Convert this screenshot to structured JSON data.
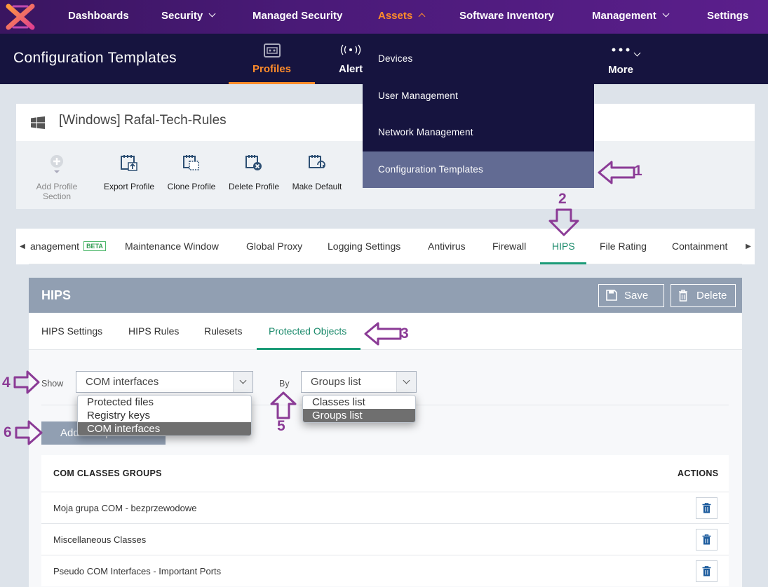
{
  "topnav": {
    "items": [
      {
        "label": "Dashboards"
      },
      {
        "label": "Security"
      },
      {
        "label": "Managed Security"
      },
      {
        "label": "Assets"
      },
      {
        "label": "Software Inventory"
      },
      {
        "label": "Management"
      },
      {
        "label": "Settings"
      }
    ],
    "active": "Assets"
  },
  "subheader": {
    "title": "Configuration Templates",
    "tabs": [
      {
        "label": "Profiles",
        "icon": "profiles-icon"
      },
      {
        "label": "Alert",
        "icon": "alerts-icon"
      },
      {
        "label": "More",
        "icon": "more-dots-icon"
      }
    ]
  },
  "assets_menu": {
    "items": [
      "Devices",
      "User Management",
      "Network Management",
      "Configuration Templates"
    ],
    "selected": "Configuration Templates"
  },
  "profile": {
    "name": "[Windows] Rafal-Tech-Rules",
    "os_icon": "windows-icon",
    "toolbar": {
      "add_section": "Add Profile Section",
      "export": "Export Profile",
      "clone": "Clone Profile",
      "delete": "Delete Profile",
      "make_default": "Make Default"
    }
  },
  "section_tabs": {
    "items": [
      {
        "label": "anagement",
        "badge": "BETA"
      },
      {
        "label": "Maintenance Window"
      },
      {
        "label": "Global Proxy"
      },
      {
        "label": "Logging Settings"
      },
      {
        "label": "Antivirus"
      },
      {
        "label": "Firewall"
      },
      {
        "label": "HIPS"
      },
      {
        "label": "File Rating"
      },
      {
        "label": "Containment"
      }
    ],
    "active": "HIPS"
  },
  "hips": {
    "title": "HIPS",
    "save_label": "Save",
    "delete_label": "Delete",
    "tabs": [
      "HIPS Settings",
      "HIPS Rules",
      "Rulesets",
      "Protected Objects"
    ],
    "active_tab": "Protected Objects",
    "filters": {
      "show_label": "Show",
      "show_value": "COM interfaces",
      "show_options": [
        "Protected files",
        "Registry keys",
        "COM interfaces"
      ],
      "by_label": "By",
      "by_value": "Groups list",
      "by_options": [
        "Classes list",
        "Groups list"
      ]
    },
    "add_button": "Add Group",
    "table": {
      "headers": [
        "COM CLASSES GROUPS",
        "ACTIONS"
      ],
      "rows": [
        "Moja grupa COM - bezprzewodowe",
        "Miscellaneous Classes",
        "Pseudo COM Interfaces - Important Ports"
      ]
    }
  },
  "annotations": [
    "1",
    "2",
    "3",
    "4",
    "5",
    "6"
  ],
  "colors": {
    "accent_orange": "#ff8c2a",
    "accent_green": "#1b9b77",
    "nav_purple": "#4a1a78",
    "annotation_purple": "#8b3b96"
  }
}
